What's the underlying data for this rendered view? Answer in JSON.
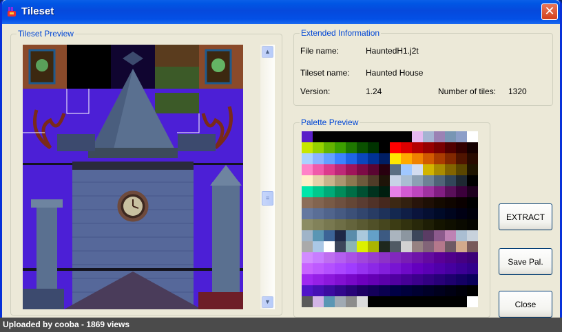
{
  "window": {
    "title": "Tileset",
    "close_glyph": "✕",
    "icon": "jazz-rabbit-icon"
  },
  "tileset_preview": {
    "title": "Tileset Preview",
    "scroll_up_glyph": "▲",
    "scroll_down_glyph": "▼",
    "thumb_glyph": "≡",
    "scroll_position": 0.58
  },
  "extended_info": {
    "title": "Extended Information",
    "file_name_label": "File name:",
    "file_name_value": "HauntedH1.j2t",
    "tileset_name_label": "Tileset name:",
    "tileset_name_value": "Haunted House",
    "version_label": "Version:",
    "version_value": "1.24",
    "tiles_label": "Number of tiles:",
    "tiles_value": "1320"
  },
  "palette_preview": {
    "title": "Palette Preview"
  },
  "buttons": {
    "extract": "EXTRACT",
    "save_pal": "Save Pal.",
    "close": "Close"
  },
  "footer": {
    "text": "Uploaded by cooba - 1869 views"
  },
  "colors": {
    "title_bar": "#0054e3",
    "group_title": "#0046d5",
    "tileset_bg": "#4a1ed2"
  },
  "palette_rows": [
    [
      "#5a1ec8",
      "#000",
      "#000",
      "#000",
      "#000",
      "#000",
      "#000",
      "#000",
      "#000",
      "#000",
      "#e6b9f0",
      "#a5b4d2",
      "#9b82b4",
      "#7896b4",
      "#8c9ec8",
      "#ffffff"
    ],
    [
      "#c8e600",
      "#96d200",
      "#64b400",
      "#3ca000",
      "#1e7800",
      "#0a5000",
      "#003200",
      "#000",
      "#ff0000",
      "#dc0000",
      "#b40000",
      "#960000",
      "#780000",
      "#500000",
      "#320000",
      "#140000"
    ],
    [
      "#aad2ff",
      "#8cb4ff",
      "#64a0ff",
      "#3c82ff",
      "#1e64e6",
      "#0a46be",
      "#003296",
      "#001e64",
      "#ffe600",
      "#ffaa00",
      "#f08200",
      "#d25a00",
      "#aa3c00",
      "#822800",
      "#501400",
      "#280a00"
    ],
    [
      "#ff82c8",
      "#f05aaa",
      "#dc3c8c",
      "#be2878",
      "#a0145a",
      "#7d0a46",
      "#5a0532",
      "#28000f",
      "#5a6e82",
      "#a0c8ff",
      "#d2dcf0",
      "#d2b400",
      "#aa8c00",
      "#826400",
      "#5a4600",
      "#1e1400"
    ],
    [
      "#fff0c8",
      "#e6d2aa",
      "#c8b48c",
      "#aa9670",
      "#8c7850",
      "#6e5a3c",
      "#503c28",
      "#1e1408",
      "#c8d2e6",
      "#aabed2",
      "#8ca0b4",
      "#6e8296",
      "#506478",
      "#32465a",
      "#1e2832",
      "#000"
    ],
    [
      "#00e6aa",
      "#00c88c",
      "#00aa78",
      "#008c5a",
      "#006e46",
      "#005032",
      "#00321e",
      "#001e0f",
      "#e680e6",
      "#d25ad2",
      "#be46be",
      "#a032a0",
      "#821e82",
      "#5a0f5a",
      "#3c003c",
      "#1e001e"
    ],
    [
      "#8c6e5a",
      "#826450",
      "#785a46",
      "#6e5040",
      "#644636",
      "#5a3c32",
      "#503228",
      "#46281e",
      "#3c2814",
      "#32200f",
      "#28140a",
      "#1e0f05",
      "#140a00",
      "#0f0500",
      "#0a0000",
      "#000"
    ],
    [
      "#6478a0",
      "#5a6e96",
      "#50648c",
      "#465a82",
      "#3c5078",
      "#32466e",
      "#283c64",
      "#1e325a",
      "#142850",
      "#0f1e46",
      "#0a143c",
      "#050f32",
      "#000a28",
      "#00051e",
      "#000014",
      "#00000a"
    ],
    [
      "#8c8c64",
      "#82825a",
      "#787850",
      "#6e6e46",
      "#64643c",
      "#5a5a32",
      "#505028",
      "#46461e",
      "#3c3c14",
      "#32320f",
      "#28280a",
      "#1e1e05",
      "#141400",
      "#0f0f00",
      "#0a0a00",
      "#050500"
    ],
    [
      "#a0b4c8",
      "#5a96b4",
      "#3c6496",
      "#1e2846",
      "#5a8caa",
      "#aac8dc",
      "#64a0c8",
      "#3c5a82",
      "#aab4be",
      "#8c96a0",
      "#3c465a",
      "#5a3c64",
      "#8c5a8c",
      "#be82b4",
      "#aabed2",
      "#c8d2dc"
    ],
    [
      "#aaaaaa",
      "#aac8e6",
      "#ffffff",
      "#3c465a",
      "#8cb4b4",
      "#dcf000",
      "#aab400",
      "#1e281e",
      "#505a64",
      "#d2d2d2",
      "#968282",
      "#826478",
      "#b4788c",
      "#6e5a64",
      "#d2aa8c",
      "#785a5a"
    ],
    [
      "#d28cff",
      "#c87dff",
      "#be6ef0",
      "#b45ff0",
      "#aa50e6",
      "#a046dc",
      "#963cd2",
      "#8c32c8",
      "#8228be",
      "#781eb4",
      "#6e14aa",
      "#640aa0",
      "#5a0096",
      "#50008c",
      "#460082",
      "#3c0078"
    ],
    [
      "#c864ff",
      "#be5aff",
      "#b450ff",
      "#aa46ff",
      "#a03cff",
      "#9632f0",
      "#8c28e6",
      "#821edc",
      "#7814d2",
      "#6e0ac8",
      "#6400be",
      "#5a00b4",
      "#5000aa",
      "#4600a0",
      "#3c0096",
      "#32008c"
    ],
    [
      "#a028f0",
      "#9620e6",
      "#8c18dc",
      "#8210d2",
      "#7808c8",
      "#6e00be",
      "#6400b4",
      "#5a00aa",
      "#5000a0",
      "#460096",
      "#3c008c",
      "#320082",
      "#280078",
      "#1e006e",
      "#140064",
      "#0a005a"
    ],
    [
      "#5014c8",
      "#4610b4",
      "#3c0ca0",
      "#32088c",
      "#280478",
      "#1e0064",
      "#14005a",
      "#0a0050",
      "#000046",
      "#00003c",
      "#000032",
      "#000028",
      "#00001e",
      "#000014",
      "#00000a",
      "#000000"
    ],
    [
      "#5a5a5a",
      "#d2b4e6",
      "#5a96b4",
      "#a0aab4",
      "#8c8c8c",
      "#dcdcdc",
      "#000",
      "#000",
      "#000",
      "#000",
      "#000",
      "#000",
      "#000",
      "#000",
      "#000",
      "#ffffff"
    ]
  ]
}
